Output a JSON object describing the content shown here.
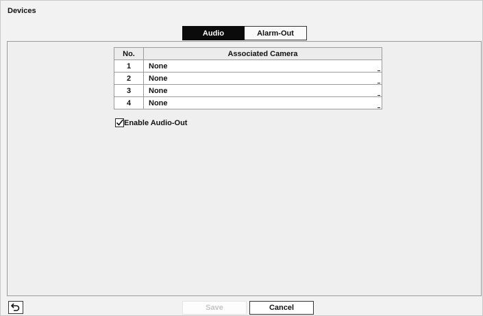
{
  "window": {
    "title": "Devices"
  },
  "tabs": [
    {
      "label": "Audio",
      "active": true
    },
    {
      "label": "Alarm-Out",
      "active": false
    }
  ],
  "table": {
    "headers": {
      "no": "No.",
      "camera": "Associated Camera"
    },
    "rows": [
      {
        "no": "1",
        "camera": "None"
      },
      {
        "no": "2",
        "camera": "None"
      },
      {
        "no": "3",
        "camera": "None"
      },
      {
        "no": "4",
        "camera": "None"
      }
    ]
  },
  "enable_audio_out": {
    "label": "Enable Audio-Out",
    "checked": true
  },
  "footer": {
    "back_icon": "undo-arrow-icon",
    "save_label": "Save",
    "save_enabled": false,
    "cancel_label": "Cancel"
  },
  "colors": {
    "active_tab_bg": "#0b0b0b",
    "panel_bg": "#efefef"
  }
}
